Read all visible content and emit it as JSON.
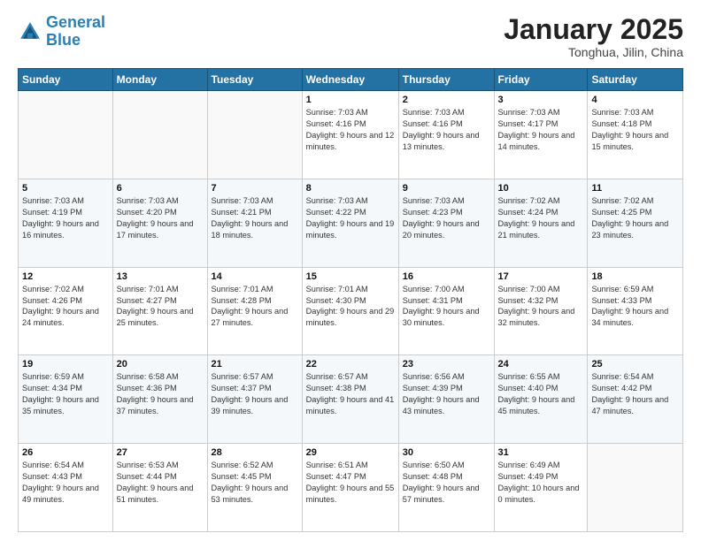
{
  "logo": {
    "line1": "General",
    "line2": "Blue"
  },
  "title": "January 2025",
  "subtitle": "Tonghua, Jilin, China",
  "days_of_week": [
    "Sunday",
    "Monday",
    "Tuesday",
    "Wednesday",
    "Thursday",
    "Friday",
    "Saturday"
  ],
  "weeks": [
    [
      {
        "day": "",
        "info": ""
      },
      {
        "day": "",
        "info": ""
      },
      {
        "day": "",
        "info": ""
      },
      {
        "day": "1",
        "info": "Sunrise: 7:03 AM\nSunset: 4:16 PM\nDaylight: 9 hours and 12 minutes."
      },
      {
        "day": "2",
        "info": "Sunrise: 7:03 AM\nSunset: 4:16 PM\nDaylight: 9 hours and 13 minutes."
      },
      {
        "day": "3",
        "info": "Sunrise: 7:03 AM\nSunset: 4:17 PM\nDaylight: 9 hours and 14 minutes."
      },
      {
        "day": "4",
        "info": "Sunrise: 7:03 AM\nSunset: 4:18 PM\nDaylight: 9 hours and 15 minutes."
      }
    ],
    [
      {
        "day": "5",
        "info": "Sunrise: 7:03 AM\nSunset: 4:19 PM\nDaylight: 9 hours and 16 minutes."
      },
      {
        "day": "6",
        "info": "Sunrise: 7:03 AM\nSunset: 4:20 PM\nDaylight: 9 hours and 17 minutes."
      },
      {
        "day": "7",
        "info": "Sunrise: 7:03 AM\nSunset: 4:21 PM\nDaylight: 9 hours and 18 minutes."
      },
      {
        "day": "8",
        "info": "Sunrise: 7:03 AM\nSunset: 4:22 PM\nDaylight: 9 hours and 19 minutes."
      },
      {
        "day": "9",
        "info": "Sunrise: 7:03 AM\nSunset: 4:23 PM\nDaylight: 9 hours and 20 minutes."
      },
      {
        "day": "10",
        "info": "Sunrise: 7:02 AM\nSunset: 4:24 PM\nDaylight: 9 hours and 21 minutes."
      },
      {
        "day": "11",
        "info": "Sunrise: 7:02 AM\nSunset: 4:25 PM\nDaylight: 9 hours and 23 minutes."
      }
    ],
    [
      {
        "day": "12",
        "info": "Sunrise: 7:02 AM\nSunset: 4:26 PM\nDaylight: 9 hours and 24 minutes."
      },
      {
        "day": "13",
        "info": "Sunrise: 7:01 AM\nSunset: 4:27 PM\nDaylight: 9 hours and 25 minutes."
      },
      {
        "day": "14",
        "info": "Sunrise: 7:01 AM\nSunset: 4:28 PM\nDaylight: 9 hours and 27 minutes."
      },
      {
        "day": "15",
        "info": "Sunrise: 7:01 AM\nSunset: 4:30 PM\nDaylight: 9 hours and 29 minutes."
      },
      {
        "day": "16",
        "info": "Sunrise: 7:00 AM\nSunset: 4:31 PM\nDaylight: 9 hours and 30 minutes."
      },
      {
        "day": "17",
        "info": "Sunrise: 7:00 AM\nSunset: 4:32 PM\nDaylight: 9 hours and 32 minutes."
      },
      {
        "day": "18",
        "info": "Sunrise: 6:59 AM\nSunset: 4:33 PM\nDaylight: 9 hours and 34 minutes."
      }
    ],
    [
      {
        "day": "19",
        "info": "Sunrise: 6:59 AM\nSunset: 4:34 PM\nDaylight: 9 hours and 35 minutes."
      },
      {
        "day": "20",
        "info": "Sunrise: 6:58 AM\nSunset: 4:36 PM\nDaylight: 9 hours and 37 minutes."
      },
      {
        "day": "21",
        "info": "Sunrise: 6:57 AM\nSunset: 4:37 PM\nDaylight: 9 hours and 39 minutes."
      },
      {
        "day": "22",
        "info": "Sunrise: 6:57 AM\nSunset: 4:38 PM\nDaylight: 9 hours and 41 minutes."
      },
      {
        "day": "23",
        "info": "Sunrise: 6:56 AM\nSunset: 4:39 PM\nDaylight: 9 hours and 43 minutes."
      },
      {
        "day": "24",
        "info": "Sunrise: 6:55 AM\nSunset: 4:40 PM\nDaylight: 9 hours and 45 minutes."
      },
      {
        "day": "25",
        "info": "Sunrise: 6:54 AM\nSunset: 4:42 PM\nDaylight: 9 hours and 47 minutes."
      }
    ],
    [
      {
        "day": "26",
        "info": "Sunrise: 6:54 AM\nSunset: 4:43 PM\nDaylight: 9 hours and 49 minutes."
      },
      {
        "day": "27",
        "info": "Sunrise: 6:53 AM\nSunset: 4:44 PM\nDaylight: 9 hours and 51 minutes."
      },
      {
        "day": "28",
        "info": "Sunrise: 6:52 AM\nSunset: 4:45 PM\nDaylight: 9 hours and 53 minutes."
      },
      {
        "day": "29",
        "info": "Sunrise: 6:51 AM\nSunset: 4:47 PM\nDaylight: 9 hours and 55 minutes."
      },
      {
        "day": "30",
        "info": "Sunrise: 6:50 AM\nSunset: 4:48 PM\nDaylight: 9 hours and 57 minutes."
      },
      {
        "day": "31",
        "info": "Sunrise: 6:49 AM\nSunset: 4:49 PM\nDaylight: 10 hours and 0 minutes."
      },
      {
        "day": "",
        "info": ""
      }
    ]
  ]
}
